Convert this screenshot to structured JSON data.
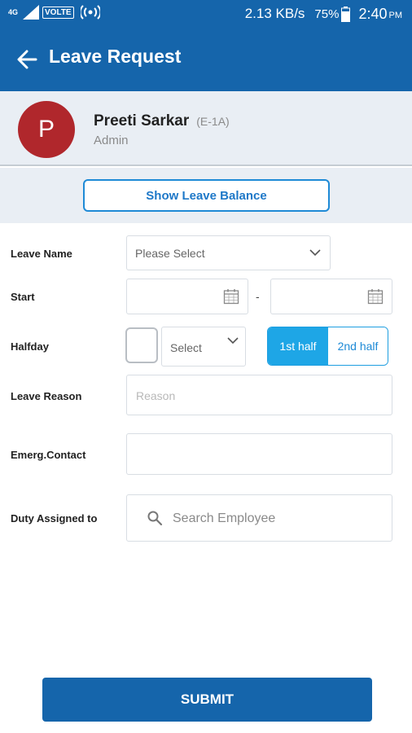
{
  "status_bar": {
    "network": "4G",
    "volte": "VOLTE",
    "speed": "2.13 KB/s",
    "battery": "75%",
    "time": "2:40",
    "ampm": "PM"
  },
  "app_bar": {
    "title": "Leave Request",
    "back_icon": "arrow-left-icon"
  },
  "profile": {
    "initial": "P",
    "name": "Preeti Sarkar",
    "code": "(E-1A)",
    "role": "Admin",
    "avatar_color": "#b0272c"
  },
  "balance_button": "Show Leave Balance",
  "form": {
    "leave_name": {
      "label": "Leave Name",
      "placeholder": "Please Select"
    },
    "start": {
      "label": "Start",
      "separator": "-",
      "from_value": "",
      "to_value": ""
    },
    "halfday": {
      "label": "Halfday",
      "checked": false,
      "select_placeholder": "Select",
      "options": [
        "1st half",
        "2nd half"
      ],
      "selected": "1st half"
    },
    "leave_reason": {
      "label": "Leave Reason",
      "placeholder": "Reason"
    },
    "emergency_contact": {
      "label": "Emerg.Contact",
      "value": ""
    },
    "duty_assigned": {
      "label": "Duty Assigned to",
      "placeholder": "Search Employee"
    }
  },
  "submit_label": "SUBMIT",
  "colors": {
    "primary": "#1565ab",
    "accent": "#1ea6e6",
    "header_bg": "#e9eef4"
  }
}
